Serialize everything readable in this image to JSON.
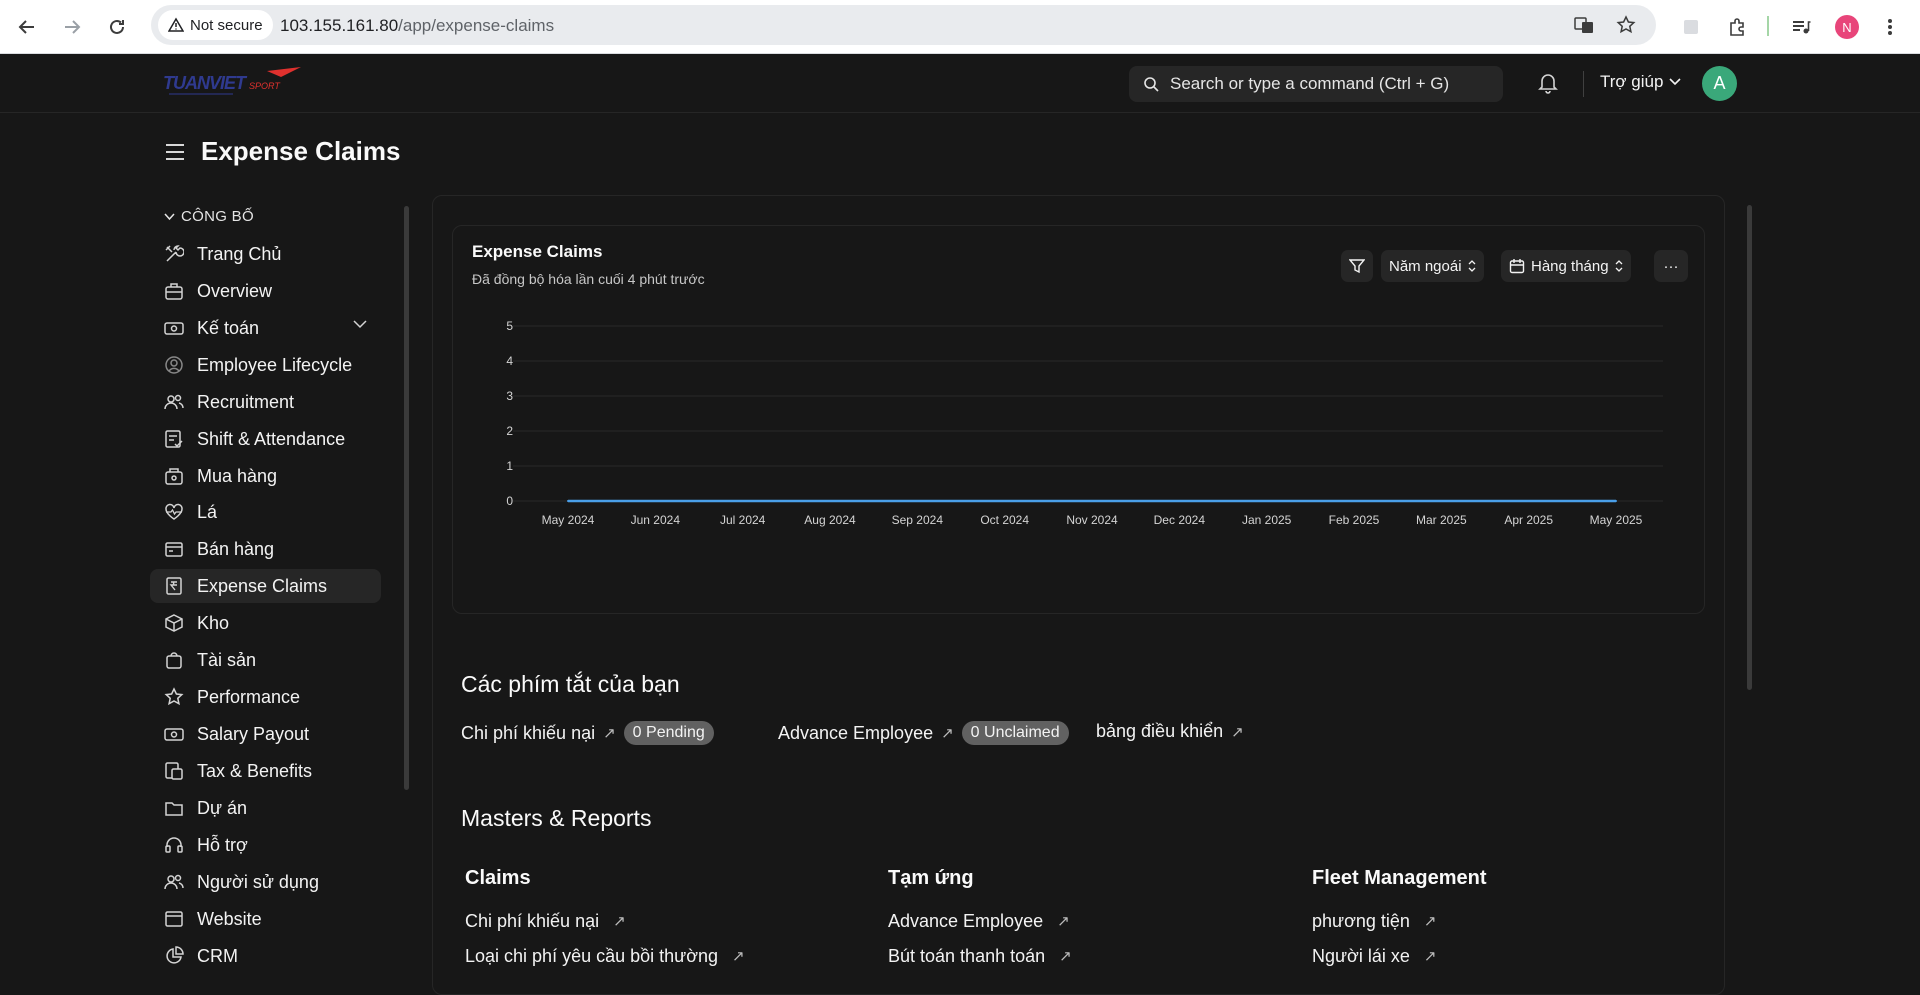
{
  "browser": {
    "security_label": "Not secure",
    "url_host": "103.155.161.80",
    "url_path": "/app/expense-claims",
    "profile_initial": "N"
  },
  "navbar": {
    "logo_text": "TUANVIETSPORT",
    "search_placeholder": "Search or type a command (Ctrl + G)",
    "help_label": "Trợ giúp",
    "avatar_initial": "A"
  },
  "page": {
    "title": "Expense Claims"
  },
  "sidebar": {
    "section_label": "CÔNG BỐ",
    "items": [
      {
        "label": "Trang Chủ",
        "icon": "tools-icon"
      },
      {
        "label": "Overview",
        "icon": "briefcase-icon"
      },
      {
        "label": "Kế toán",
        "icon": "money-icon"
      },
      {
        "label": "Employee Lifecycle",
        "icon": "user-circle-icon"
      },
      {
        "label": "Recruitment",
        "icon": "users-icon"
      },
      {
        "label": "Shift & Attendance",
        "icon": "checklist-icon"
      },
      {
        "label": "Mua hàng",
        "icon": "purchase-icon"
      },
      {
        "label": "Lá",
        "icon": "heartbeat-icon"
      },
      {
        "label": "Bán hàng",
        "icon": "sales-icon"
      },
      {
        "label": "Expense Claims",
        "icon": "rupee-receipt-icon"
      },
      {
        "label": "Kho",
        "icon": "box-icon"
      },
      {
        "label": "Tài sản",
        "icon": "bag-icon"
      },
      {
        "label": "Performance",
        "icon": "star-icon"
      },
      {
        "label": "Salary Payout",
        "icon": "money-icon"
      },
      {
        "label": "Tax & Benefits",
        "icon": "document-icon"
      },
      {
        "label": "Dự án",
        "icon": "folder-icon"
      },
      {
        "label": "Hỗ trợ",
        "icon": "headset-icon"
      },
      {
        "label": "Người sử dụng",
        "icon": "users-icon"
      },
      {
        "label": "Website",
        "icon": "browser-icon"
      },
      {
        "label": "CRM",
        "icon": "pie-chart-icon"
      }
    ]
  },
  "chart_card": {
    "title": "Expense Claims",
    "subtitle": "Đã đồng bộ hóa lần cuối 4 phút trước",
    "period_label": "Năm ngoái",
    "interval_label": "Hàng tháng",
    "more_label": "···"
  },
  "chart_data": {
    "type": "line",
    "categories": [
      "May 2024",
      "Jun 2024",
      "Jul 2024",
      "Aug 2024",
      "Sep 2024",
      "Oct 2024",
      "Nov 2024",
      "Dec 2024",
      "Jan 2025",
      "Feb 2025",
      "Mar 2025",
      "Apr 2025",
      "May 2025"
    ],
    "series": [
      {
        "values": [
          0,
          0,
          0,
          0,
          0,
          0,
          0,
          0,
          0,
          0,
          0,
          0,
          0
        ]
      }
    ],
    "ylim": [
      0,
      5
    ],
    "yticks": [
      0,
      1,
      2,
      3,
      4,
      5
    ],
    "grid": true,
    "line_color": "#4a9fe8"
  },
  "shortcuts": {
    "title": "Các phím tắt của bạn",
    "items": [
      {
        "label": "Chi phí khiếu nại",
        "badge": "0 Pending"
      },
      {
        "label": "Advance Employee",
        "badge": "0 Unclaimed"
      },
      {
        "label": "bảng điều khiển",
        "badge": ""
      }
    ]
  },
  "masters": {
    "title": "Masters & Reports",
    "columns": [
      {
        "title": "Claims",
        "links": [
          "Chi phí khiếu nại",
          "Loại chi phí yêu cầu bồi thường"
        ]
      },
      {
        "title": "Tạm ứng",
        "links": [
          "Advance Employee",
          "Bút toán thanh toán"
        ]
      },
      {
        "title": "Fleet Management",
        "links": [
          "phương tiện",
          "Người lái xe"
        ]
      }
    ]
  }
}
